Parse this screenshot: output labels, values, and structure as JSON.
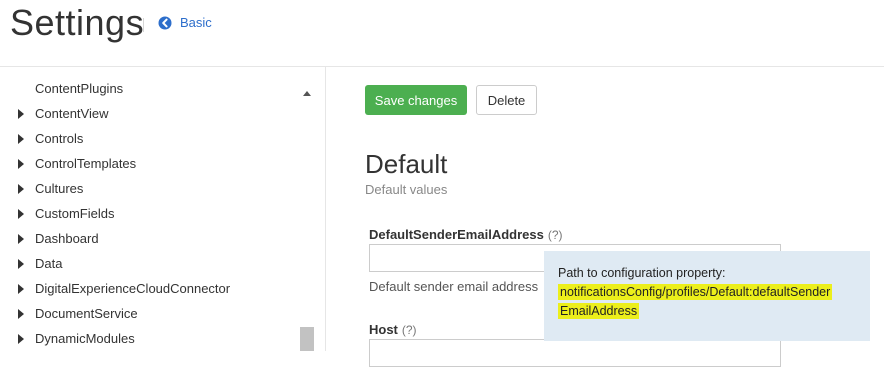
{
  "header": {
    "title": "Settings",
    "back_link": "Basic"
  },
  "sidebar": {
    "items": [
      {
        "label": "ContentPlugins",
        "expandable": false
      },
      {
        "label": "ContentView",
        "expandable": true
      },
      {
        "label": "Controls",
        "expandable": true
      },
      {
        "label": "ControlTemplates",
        "expandable": true
      },
      {
        "label": "Cultures",
        "expandable": true
      },
      {
        "label": "CustomFields",
        "expandable": true
      },
      {
        "label": "Dashboard",
        "expandable": true
      },
      {
        "label": "Data",
        "expandable": true
      },
      {
        "label": "DigitalExperienceCloudConnector",
        "expandable": true
      },
      {
        "label": "DocumentService",
        "expandable": true
      },
      {
        "label": "DynamicModules",
        "expandable": true
      }
    ]
  },
  "toolbar": {
    "save_label": "Save changes",
    "delete_label": "Delete"
  },
  "section": {
    "title": "Default",
    "subtitle": "Default values"
  },
  "fields": [
    {
      "label": "DefaultSenderEmailAddress",
      "help": "(?)",
      "value": "",
      "description": "Default sender email address"
    },
    {
      "label": "Host",
      "help": "(?)",
      "value": ""
    }
  ],
  "tooltip": {
    "heading": "Path to configuration property:",
    "path_part1": "notificationsConfig/profiles/Default:defaultSender",
    "path_part2": "EmailAddress"
  },
  "colors": {
    "accent_link": "#2d6ecb",
    "save_button": "#4caf50",
    "tooltip_bg": "#dfeaf3",
    "highlight": "#ecef1b"
  }
}
